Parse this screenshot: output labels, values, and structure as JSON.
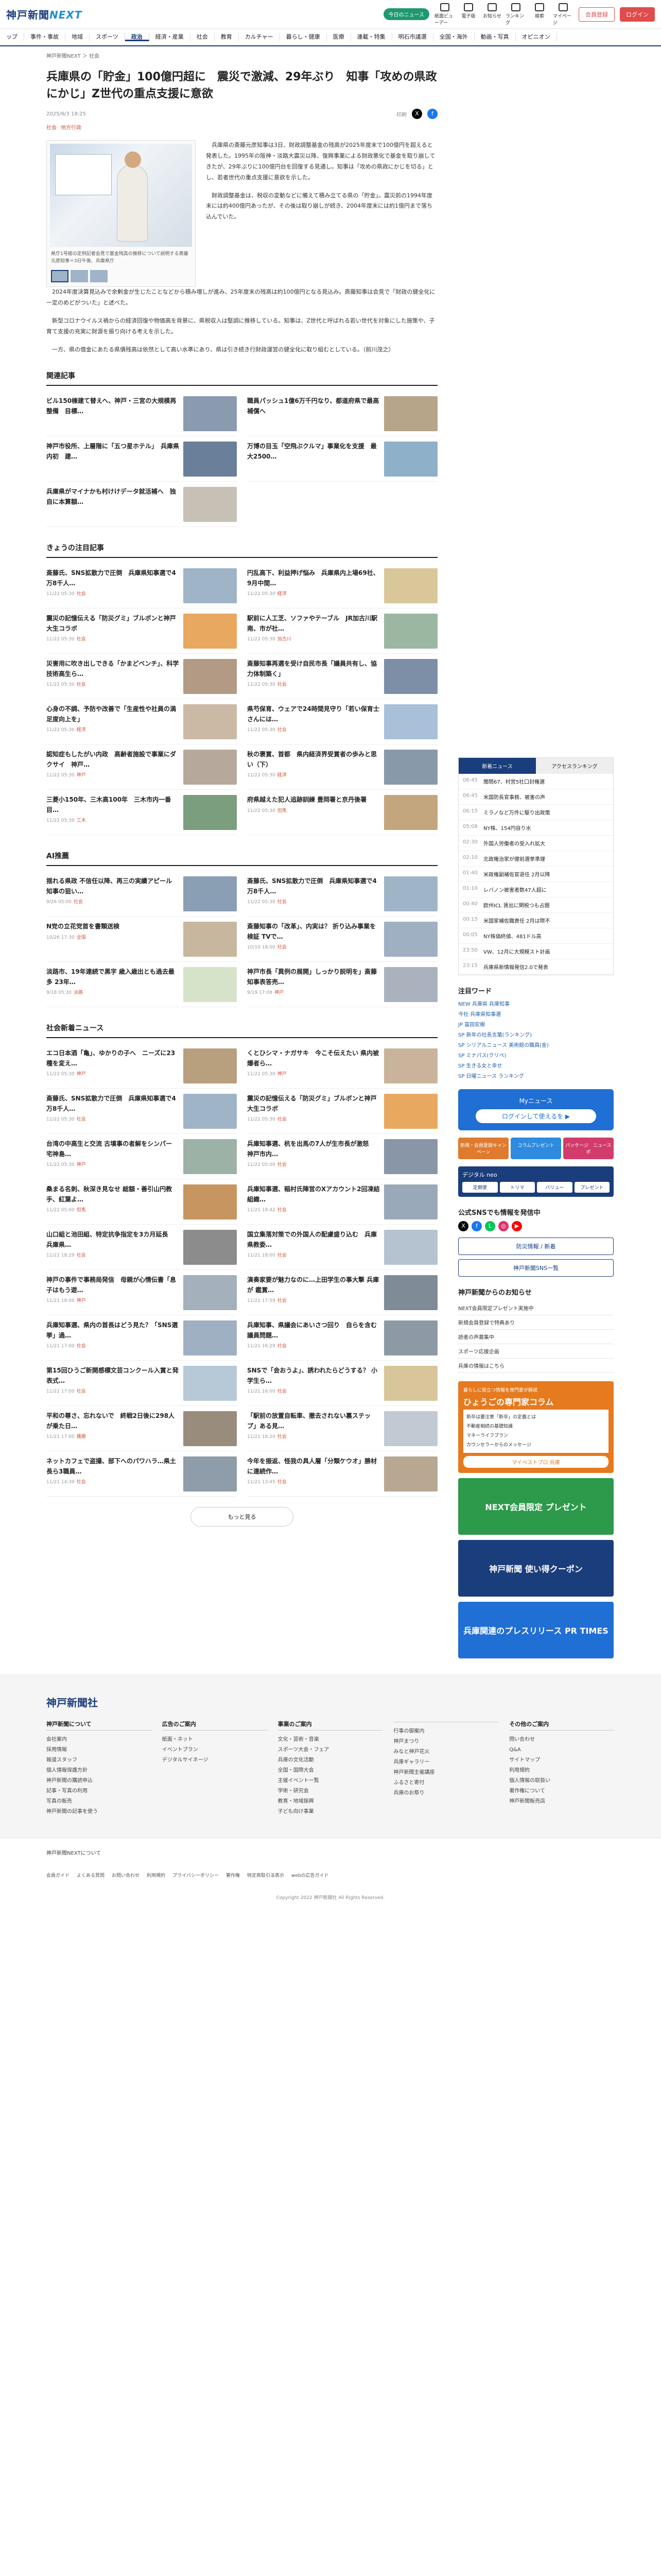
{
  "header": {
    "logo": "神戸新聞",
    "logo_next": "NEXT",
    "free_news": "今日のニュース",
    "icons": [
      "紙面ビューアー",
      "電子版",
      "お知らせ",
      "ランキング",
      "検索",
      "マイページ"
    ],
    "register": "会員登録",
    "login": "ログイン"
  },
  "nav": [
    "ップ",
    "事件・事故",
    "地域",
    "スポーツ",
    "政治",
    "経済・産業",
    "社会",
    "教育",
    "カルチャー",
    "暮らし・健康",
    "医療",
    "連載・特集",
    "明石市議選",
    "全国・海外",
    "動画・写真",
    "オピニオン"
  ],
  "nav_active": 4,
  "breadcrumb": "神戸新聞NEXT ＞ 社会",
  "article": {
    "title": "兵庫県の「貯金」100億円超に　震災で激減、29年ぶり　知事「攻めの県政にかじ」Z世代の重点支援に意欲",
    "date": "2025/6/3 18:25",
    "print": "印刷",
    "tags": [
      "社会",
      "地方行政"
    ],
    "caption": "県庁1号館の定例記者会見で基金残高の推移について説明する斎藤元彦知事＝3日午後、兵庫県庁",
    "paragraphs": [
      "兵庫県の斎藤元彦知事は3日、財政調整基金の残高が2025年度末で100億円を超えると発表した。1995年の阪神・淡路大震災以降、復興事業による財政悪化で基金を取り崩してきたが、29年ぶりに100億円台を回復する見通し。知事は「攻めの県政にかじを切る」とし、若者世代の重点支援に意欲を示した。",
      "財政調整基金は、税収の変動などに備えて積み立てる県の「貯金」。震災前の1994年度末には約400億円あったが、その後は取り崩しが続き、2004年度末には約1億円まで落ち込んでいた。",
      "2024年度決算見込みで余剰金が生じたことなどから積み増しが進み、25年度末の残高は約100億円となる見込み。斎藤知事は会見で「財政の健全化に一定のめどがついた」と述べた。",
      "新型コロナウイルス禍からの経済回復や物価高を背景に、県税収入は堅調に推移している。知事は、Z世代と呼ばれる若い世代を対象にした施策や、子育て支援の充実に財源を振り向ける考えを示した。",
      "一方、県の借金にあたる県債残高は依然として高い水準にあり、県は引き続き行財政運営の健全化に取り組むとしている。（前川茂之）"
    ]
  },
  "related": {
    "title": "関連記事",
    "items": [
      {
        "t": "ビル150棟建て替えへ、神戸・三宮の大規模再整備　目標…",
        "d": "",
        "c": "#8a9bb0"
      },
      {
        "t": "職員パッシュ1億6万千円なり、都道府県で最高補償へ",
        "d": "",
        "c": "#b7a58a"
      },
      {
        "t": "神戸市役所、上層階に「五つ星ホテル」　兵庫県内初　建…",
        "d": "",
        "c": "#6a7f99"
      },
      {
        "t": "万博の目玉「空飛ぶクルマ」事業化を支援　最大2500…",
        "d": "",
        "c": "#8fb0c9"
      },
      {
        "t": "兵庫県がマイナかも村けけデータ就活補へ　独自に本算額…",
        "d": "",
        "c": "#c7c1b5"
      }
    ]
  },
  "today": {
    "title": "きょうの注目記事",
    "items": [
      {
        "t": "斎藤氏、SNS拡散力で圧倒　兵庫県知事選で4万8千人…",
        "d": "11/22 05:30",
        "k": "社会",
        "c": "#a0b4c8"
      },
      {
        "t": "円乱高下、利益押げ悩み　兵庫県内上場69社、9月中間…",
        "d": "11/22 05:30",
        "k": "経済",
        "c": "#d9c79a"
      },
      {
        "t": "",
        "d": "",
        "k": "",
        "c": ""
      },
      {
        "t": "震災の記憶伝える「防災グミ」ブルボンと神戸大生コラボ",
        "d": "11/22 05:30",
        "k": "社会",
        "c": "#e8a860"
      },
      {
        "t": "駅前に人工芝、ソファやテーブル　JR加古川駅南、市が社…",
        "d": "11/22 05:30",
        "k": "加古川",
        "c": "#9cb7a1"
      },
      {
        "t": "災害用に吹き出しできる「かまどベンチ」、科学技術高生ら…",
        "d": "11/22 05:30",
        "k": "社会",
        "c": "#b39a85"
      },
      {
        "t": "斎藤知事再選を受け自民市長「議員共有し、協力体制築く」",
        "d": "11/22 05:30",
        "k": "社会",
        "c": "#7d8fa6"
      },
      {
        "t": "心身の不調、予防や改善で「生産性や社員の満足度向上を」",
        "d": "11/22 05:30",
        "k": "経済",
        "c": "#cbb9a6"
      },
      {
        "t": "県芍保育、ウェアで24時間見守り「若い保育士さんには…",
        "d": "11/22 05:30",
        "k": "社会",
        "c": "#a8c0d8"
      },
      {
        "t": "認知症もしたがい内政　高齢者施設で事業にダクサイ　神戸…",
        "d": "11/22 05:30",
        "k": "神戸",
        "c": "#b6a89a"
      },
      {
        "t": "秋の褒賞、首都　県内経済界受賞者の歩みと思い（下）",
        "d": "11/22 05:30",
        "k": "経済",
        "c": "#8899aa"
      },
      {
        "t": "",
        "d": "",
        "k": "",
        "c": ""
      },
      {
        "t": "三菱小150年、三木高100年　三木市内一番目…",
        "d": "11/22 05:30",
        "k": "三木",
        "c": "#7a9e7e"
      },
      {
        "t": "府県越えた犯人追跡訓練 豊岡署と京丹後署",
        "d": "11/22 05:30",
        "k": "但馬",
        "c": "#c4a67e"
      }
    ]
  },
  "ai": {
    "title": "AI推薦",
    "items": [
      {
        "t": "揺れる県政 不信任以降、再三の実績アピール 知事の狙い…",
        "d": "9/26 05:00",
        "k": "社会",
        "c": "#8a9fb4"
      },
      {
        "t": "斎藤氏、SNS拡散力で圧倒　兵庫県知事選で4万8千人…",
        "d": "11/22 05:30",
        "k": "社会",
        "c": "#a0b4c8"
      },
      {
        "t": "N党の立花党首を書類送検",
        "d": "10/26 17:30",
        "k": "全国",
        "c": "#c8b79f"
      },
      {
        "t": "斎藤知事の「改革」、内実は？ 折り込み事業を検証 TVで…",
        "d": "10/10 18:00",
        "k": "社会",
        "c": "#9fb0c2"
      },
      {
        "t": "淡路市、19年連続で黒字 歳入歳出とも過去最多 23年…",
        "d": "9/18 05:30",
        "k": "淡路",
        "c": "#d7e3c9"
      },
      {
        "t": "神戸市長「異例の展開」しっかり説明を」斎藤知事表答売…",
        "d": "9/19 17:08",
        "k": "神戸",
        "c": "#aab3bd"
      }
    ]
  },
  "social": {
    "title": "社会新着ニュース",
    "items": [
      {
        "t": "エコ日本酒「亀」、ゆかりの子へ　ニーズに23種を変え…",
        "d": "11/22 05:30",
        "k": "神戸",
        "c": "#b8a07e"
      },
      {
        "t": "くとひシマ・ナガサキ　今こそ伝えたい 県内被爆者ら…",
        "d": "11/22 05:30",
        "k": "神戸",
        "c": "#c9b49b"
      },
      {
        "t": "",
        "d": "",
        "k": "",
        "c": ""
      },
      {
        "t": "斎藤氏、SNS拡散力で圧倒　兵庫県知事選で4万8千人…",
        "d": "11/22 05:30",
        "k": "社会",
        "c": "#a0b4c8"
      },
      {
        "t": "震災の記憶伝える「防災グミ」ブルボンと神戸大生コラボ",
        "d": "11/22 05:30",
        "k": "社会",
        "c": "#e8a860"
      },
      {
        "t": "台湾の中高生と交流 古墳事の者解をシンパー　宅神島…",
        "d": "11/22 05:30",
        "k": "神戸",
        "c": "#9db2a6"
      },
      {
        "t": "兵庫知事選、杭を出馬の7人が生市長が激怒　神戸市内…",
        "d": "11/22 05:00",
        "k": "社会",
        "c": "#8896a7"
      },
      {
        "t": "桑まる名刺、秋深き見なせ 総額・善引山円教手、紅葉よ…",
        "d": "11/22 05:00",
        "k": "但馬",
        "c": "#c7955f"
      },
      {
        "t": "兵庫知事選、稲村氏陣営のXアカウント2回凍結　組織…",
        "d": "11/21 18:42",
        "k": "社会",
        "c": "#9aa9b9"
      },
      {
        "t": "",
        "d": "",
        "k": "",
        "c": ""
      },
      {
        "t": "山口組と池田組、特定抗争指定を3カ月延長　兵庫県…",
        "d": "11/21 18:29",
        "k": "社会",
        "c": "#8c8c8c"
      },
      {
        "t": "国立集落対策での外国人の配慮盛り込む　兵庫県教委…",
        "d": "11/21 18:00",
        "k": "社会",
        "c": "#b4c3cf"
      },
      {
        "t": "神戸の事件で事務局発信　母親が心情伝書「息子はもう遊…",
        "d": "11/21 18:00",
        "k": "神戸",
        "c": "#a4b0bb"
      },
      {
        "t": "演奏家要が魅力なのに…上田学生の事大撃 兵庫が 鑑賞…",
        "d": "11/21 17:59",
        "k": "社会",
        "c": "#7f8c98"
      },
      {
        "t": "",
        "d": "",
        "k": "",
        "c": ""
      },
      {
        "t": "兵庫知事選、県内の首長はどう見た？「SNS選挙」過…",
        "d": "11/21 17:00",
        "k": "社会",
        "c": "#9fb0c2"
      },
      {
        "t": "兵庫知事、県議会にあいさつ回り　自らを含む議員問題…",
        "d": "11/21 16:29",
        "k": "社会",
        "c": "#8d9aa6"
      },
      {
        "t": "第15回ひうご新開感標文芸コンクール入賞と発表式…",
        "d": "11/21 17:00",
        "k": "社会",
        "c": "#b7c9d6"
      },
      {
        "t": "SNSで「会おうよ」、誘われたらどうする？ 小学生ら…",
        "d": "11/21 16:00",
        "k": "社会",
        "c": "#d8c69a"
      },
      {
        "t": "平和の尊さ、忘れないで　終戦2日後に298人が乗た日…",
        "d": "11/21 17:00",
        "k": "播磨",
        "c": "#9a8c7c"
      },
      {
        "t": "「駅前の放置自転車、撤去されない裏ステップ」ある見…",
        "d": "11/21 16:20",
        "k": "社会",
        "c": "#c1cad2"
      },
      {
        "t": "",
        "d": "",
        "k": "",
        "c": ""
      },
      {
        "t": "ネットカフェで盗撮、部下へのパワハラ…県土長ら3職員…",
        "d": "11/21 14:39",
        "k": "社会",
        "c": "#8f9ca9"
      },
      {
        "t": "今年を振返、怪我の具人層「分類ケウオ」勝材に連続作…",
        "d": "11/21 13:45",
        "k": "社会",
        "c": "#b8a892"
      }
    ]
  },
  "more_label": "もっと見る",
  "sidebar": {
    "tabs": [
      "新着ニュース",
      "アクセスランキング"
    ],
    "news": [
      {
        "time": "06:45",
        "t": "聞問67、村営5社口封権選"
      },
      {
        "time": "06:45",
        "t": "米国防長官事務、被害の声"
      },
      {
        "time": "06:15",
        "t": "ミラノなど万件に駆り出政策"
      },
      {
        "time": "05:08",
        "t": "NY株、154円自り水"
      },
      {
        "time": "02:30",
        "t": "外国人労働者の受入れ拡大"
      },
      {
        "time": "02:10",
        "t": "北政権治家が健前選挙準理"
      },
      {
        "time": "01:40",
        "t": "米政権副補佐官退任 2月以降"
      },
      {
        "time": "01:10",
        "t": "レバノン被害者数47人超に"
      },
      {
        "time": "00:40",
        "t": "欧州ICL 賃出に関税つも占題"
      },
      {
        "time": "00:15",
        "t": "米国家補佐職責任 2月は際不"
      },
      {
        "time": "00:05",
        "t": "NY株価終値、481ドル高"
      },
      {
        "time": "23:50",
        "t": "VW、12月に大規模スト計画"
      },
      {
        "time": "23:15",
        "t": "兵庫県新情報発信2.0で発表"
      }
    ],
    "keywords_title": "注目ワード",
    "keywords": [
      "NEW 兵庫県 兵庫知事",
      "今社 兵庫県知事選",
      "JP 富田宏樹",
      "SP 新年の社長言葉(ランキング)",
      "SP シリアルニュース 美術館の職員(金)",
      "SP ミナパス(クリペ)",
      "SP 生きる女と幸せ",
      "SP 日曜ニュース ランキング"
    ],
    "my": {
      "title": "Myニュース",
      "button": "ログインして使えるを ▶"
    },
    "btns": [
      {
        "t": "新規・会員登録キャンペーン",
        "c": "#e07a2e"
      },
      {
        "t": "コラムプレゼント",
        "c": "#2e8be0"
      },
      {
        "t": "パッケージ　ニュースポ",
        "c": "#d23c6b"
      }
    ],
    "digital": {
      "title": "デジタル neo",
      "items": [
        "定期便",
        "トリマ",
        "バリュー",
        "プレゼント"
      ]
    },
    "official_title": "公式SNSでも情報を発信中",
    "kobe_btn": "防災情報 / 新着",
    "sns_btn": "神戸新聞SNS一覧",
    "info_title": "神戸新聞からのお知らせ",
    "info": [
      "NEXT会員限定プレゼント実施中",
      "新規会員登録で特典あり",
      "読者の声募集中",
      "スポーツ応援企画",
      "兵庫の情報はこちら"
    ],
    "col": {
      "head": "暮らしに役立つ情報を専門家が解説",
      "title": "ひょうごの専門家コラム",
      "items": [
        "新卒は要注意「新卒」の定義とは",
        "不動産相続の基礎知識",
        "マネーライフプラン",
        "カウンセラーからのメッセージ"
      ],
      "btn": "マイベストプロ 兵庫"
    },
    "ads": [
      {
        "t": "NEXT会員限定 プレゼント",
        "c": "#2c9a4a"
      },
      {
        "t": "神戸新聞 使い得クーポン",
        "c": "#1a3d7c"
      },
      {
        "t": "兵庫関連のプレスリリース PR TIMES",
        "c": "#1f6fd4"
      }
    ]
  },
  "footer": {
    "logo": "神戸新聞社",
    "cols": [
      {
        "h": "神戸新聞について",
        "l": [
          "会社案内",
          "採用情報",
          "報道スタッフ",
          "個人情報保護方針",
          "神戸新聞の購読申込",
          "記事・写真の利用",
          "写真の販売",
          "神戸新聞の記事を使う"
        ]
      },
      {
        "h": "広告のご案内",
        "l": [
          "紙面・ネット",
          "イベントプラン",
          "デジタルサイネージ"
        ]
      },
      {
        "h": "事業のご案内",
        "l": [
          "文化・芸術・音楽",
          "スポーツ大会・フェア",
          "兵庫の文化活動",
          "全国・国際大会",
          "主催イベント一覧",
          "学術・研究会",
          "教育・地域振興",
          "子ども向け事業"
        ]
      },
      {
        "h": "",
        "l": [
          "行事の御案内",
          "神戸まつり",
          "みなと神戸花火",
          "兵庫ギャラリー",
          "神戸新聞主催講座",
          "ふるさと寄付",
          "兵庫のお祭り"
        ]
      },
      {
        "h": "その他のご案内",
        "l": [
          "問い合わせ",
          "Q&A",
          "サイトマップ",
          "利用規約",
          "個人情報の取扱い",
          "著作権について",
          "神戸新聞販売店"
        ]
      }
    ],
    "next": "神戸新聞NEXTについて",
    "links": [
      "会員ガイド",
      "よくある質問",
      "お問い合わせ",
      "利用規約",
      "プライバシーポリシー",
      "著作権",
      "特定商取引法表示",
      "webの広告ガイド"
    ],
    "copyright": "Copyright 2022 神戸新聞社 All Rights Reserved."
  }
}
